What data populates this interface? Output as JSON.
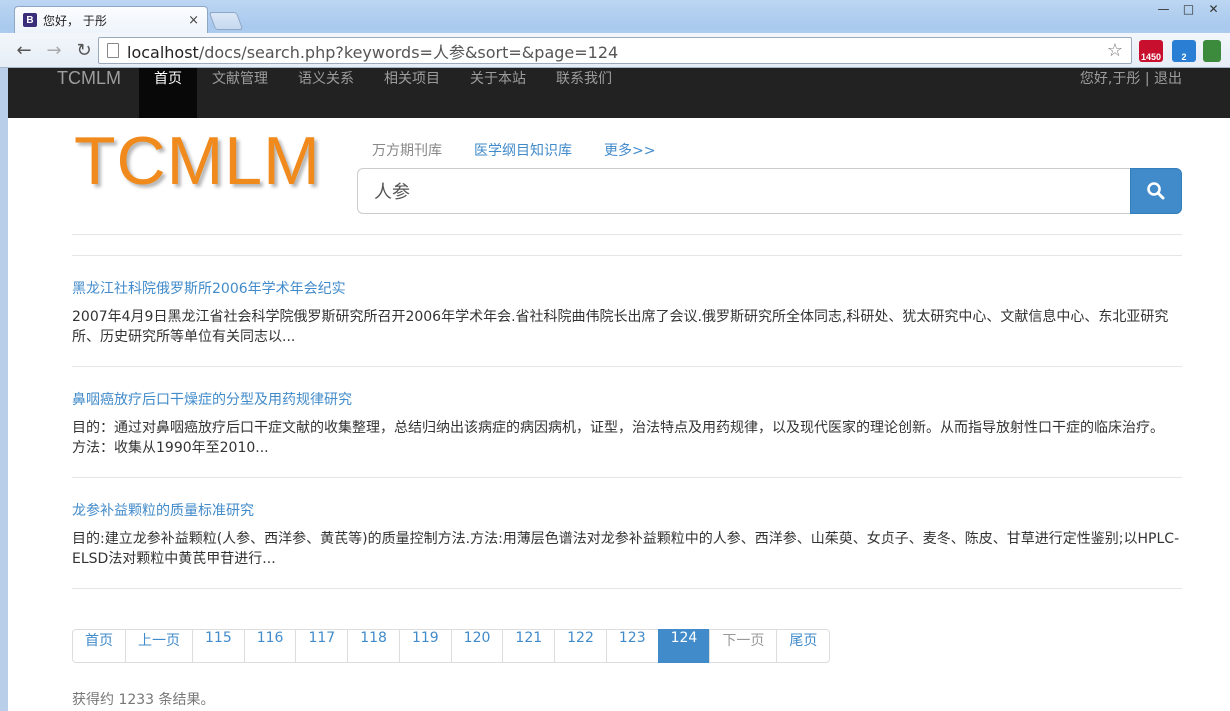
{
  "browser": {
    "tab_title": "您好， 于彤",
    "tab_favicon": "B",
    "tab_close": "×",
    "url_host": "localhost",
    "url_path": "/docs/search.php?keywords=人参&sort=&page=124",
    "back_icon": "←",
    "forward_icon": "→",
    "reload_icon": "↻",
    "star_icon": "☆",
    "ext_gmail_badge": "1450",
    "ext_blue_badge": "2",
    "window_min": "—",
    "window_max": "□",
    "window_close": "✕"
  },
  "navbar": {
    "brand": "TCMLM",
    "links": [
      "首页",
      "文献管理",
      "语义关系",
      "相关项目",
      "关于本站",
      "联系我们"
    ],
    "active_index": 0,
    "greeting": "您好,于彤 | 退出"
  },
  "header": {
    "logo": "TCMLM",
    "sources": [
      "万方期刊库",
      "医学纲目知识库",
      "更多>>"
    ],
    "search_value": "人参",
    "search_icon": "search-icon"
  },
  "results": [
    {
      "title": "黑龙江社科院俄罗斯所2006年学术年会纪实",
      "snippet": "2007年4月9日黑龙江省社会科学院俄罗斯研究所召开2006年学术年会.省社科院曲伟院长出席了会议.俄罗斯研究所全体同志,科研处、犹太研究中心、文献信息中心、东北亚研究所、历史研究所等单位有关同志以..."
    },
    {
      "title": "鼻咽癌放疗后口干燥症的分型及用药规律研究",
      "snippet": "目的：通过对鼻咽癌放疗后口干症文献的收集整理，总结归纳出该病症的病因病机，证型，治法特点及用药规律，以及现代医家的理论创新。从而指导放射性口干症的临床治疗。 方法：收集从1990年至2010..."
    },
    {
      "title": "龙参补益颗粒的质量标准研究",
      "snippet": "目的:建立龙参补益颗粒(人参、西洋参、黄芪等)的质量控制方法.方法:用薄层色谱法对龙参补益颗粒中的人参、西洋参、山茱萸、女贞子、麦冬、陈皮、甘草进行定性鉴别;以HPLC-ELSD法对颗粒中黄芪甲苷进行..."
    }
  ],
  "pagination": {
    "pages": [
      "首页",
      "上一页",
      "115",
      "116",
      "117",
      "118",
      "119",
      "120",
      "121",
      "122",
      "123",
      "124",
      "下一页",
      "尾页"
    ],
    "active": "124",
    "disabled": [
      "下一页"
    ]
  },
  "result_count": "获得约 1233 条结果。",
  "colors": {
    "accent": "#428bca",
    "navbar": "#222222",
    "logo": "#f08a1c"
  }
}
